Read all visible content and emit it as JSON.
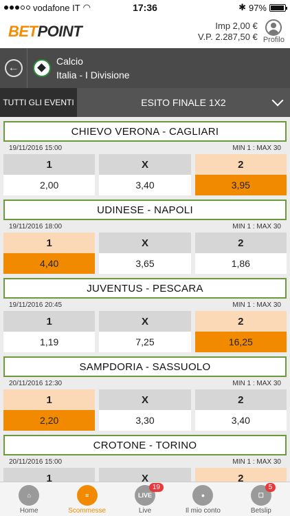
{
  "status": {
    "carrier": "vodafone IT",
    "time": "17:36",
    "battery": "97%",
    "battery_level": 0.97
  },
  "header": {
    "logo_bet": "BET",
    "logo_point": "POINT",
    "imp": "Imp 2,00 €",
    "vp": "V.P. 2.287,50 €",
    "profile_label": "Profilo"
  },
  "nav": {
    "sport": "Calcio",
    "league": "Italia - I Divisione"
  },
  "tabs": {
    "all_events": "TUTTI GLI EVENTI",
    "market": "ESITO FINALE 1X2"
  },
  "events": [
    {
      "match": "CHIEVO VERONA - CAGLIARI",
      "date": "19/11/2016 15:00",
      "limits": "MIN 1 : MAX 30",
      "odds": [
        {
          "label": "1",
          "value": "2,00"
        },
        {
          "label": "X",
          "value": "3,40"
        },
        {
          "label": "2",
          "value": "3,95"
        }
      ],
      "selected": 2
    },
    {
      "match": "UDINESE - NAPOLI",
      "date": "19/11/2016 18:00",
      "limits": "MIN 1 : MAX 30",
      "odds": [
        {
          "label": "1",
          "value": "4,40"
        },
        {
          "label": "X",
          "value": "3,65"
        },
        {
          "label": "2",
          "value": "1,86"
        }
      ],
      "selected": 0
    },
    {
      "match": "JUVENTUS - PESCARA",
      "date": "19/11/2016 20:45",
      "limits": "MIN 1 : MAX 30",
      "odds": [
        {
          "label": "1",
          "value": "1,19"
        },
        {
          "label": "X",
          "value": "7,25"
        },
        {
          "label": "2",
          "value": "16,25"
        }
      ],
      "selected": 2
    },
    {
      "match": "SAMPDORIA - SASSUOLO",
      "date": "20/11/2016 12:30",
      "limits": "MIN 1 : MAX 30",
      "odds": [
        {
          "label": "1",
          "value": "2,20"
        },
        {
          "label": "X",
          "value": "3,30"
        },
        {
          "label": "2",
          "value": "3,40"
        }
      ],
      "selected": 0
    },
    {
      "match": "CROTONE - TORINO",
      "date": "20/11/2016 15:00",
      "limits": "MIN 1 : MAX 30",
      "odds": [
        {
          "label": "1",
          "value": ""
        },
        {
          "label": "X",
          "value": ""
        },
        {
          "label": "2",
          "value": ""
        }
      ],
      "selected": 2
    }
  ],
  "bottom": {
    "home": "Home",
    "bets": "Scommesse",
    "live": "Live",
    "live_icon": "LIVE",
    "live_badge": "19",
    "account": "Il mio conto",
    "betslip": "Betslip",
    "betslip_badge": "5"
  },
  "colors": {
    "accent": "#f28a00",
    "selected_light": "#fbd9b6",
    "match_border": "#6a9a3c",
    "nav_bg": "#4a4a4a"
  }
}
